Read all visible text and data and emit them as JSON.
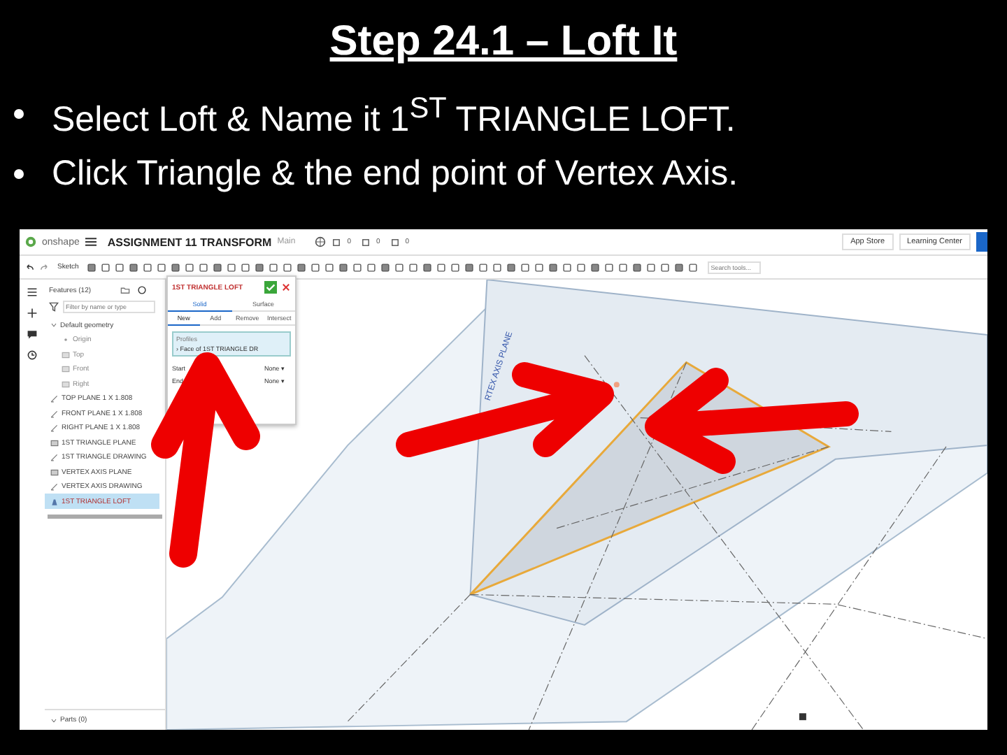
{
  "title": "Step 24.1 – Loft It",
  "bullets": [
    "Select Loft & Name it 1$^{ST}$ TRIANGLE LOFT.",
    "Click Triangle & the end point of Vertex Axis."
  ],
  "app": {
    "logo": "onshape",
    "document": "ASSIGNMENT 11 TRANSFORM",
    "branch": "Main",
    "counts": [
      "0",
      "0",
      "0"
    ],
    "header_buttons": [
      "App Store",
      "Learning Center"
    ],
    "toolbar": {
      "sketch": "Sketch",
      "search": {
        "placeholder": "Search tools..."
      }
    }
  },
  "features": {
    "title": "Features (12)",
    "filter": {
      "placeholder": "Filter by name or type"
    },
    "tree": [
      {
        "label": "Default geometry",
        "kind": "folder",
        "expanded": true,
        "selected": false,
        "children": [
          {
            "label": "Origin",
            "kind": "origin",
            "selected": false
          },
          {
            "label": "Top",
            "kind": "plane",
            "selected": false
          },
          {
            "label": "Front",
            "kind": "plane",
            "selected": false
          },
          {
            "label": "Right",
            "kind": "plane",
            "selected": false
          }
        ]
      },
      {
        "label": "TOP PLANE 1 X 1.808",
        "kind": "sketch",
        "selected": false
      },
      {
        "label": "FRONT PLANE 1 X 1.808",
        "kind": "sketch",
        "selected": false
      },
      {
        "label": "RIGHT PLANE 1 X 1.808",
        "kind": "sketch",
        "selected": false
      },
      {
        "label": "1ST TRIANGLE PLANE",
        "kind": "plane",
        "selected": false
      },
      {
        "label": "1ST TRIANGLE DRAWING",
        "kind": "sketch",
        "selected": false
      },
      {
        "label": "VERTEX AXIS PLANE",
        "kind": "plane",
        "selected": false
      },
      {
        "label": "VERTEX AXIS DRAWING",
        "kind": "sketch",
        "selected": false
      },
      {
        "label": "1ST TRIANGLE LOFT",
        "kind": "loft",
        "selected": true
      }
    ],
    "parts": {
      "label": "Parts (0)",
      "expanded": true
    }
  },
  "dialog": {
    "title": "1ST TRIANGLE LOFT",
    "tabs": [
      {
        "label": "Solid",
        "selected": true
      },
      {
        "label": "Surface",
        "selected": false
      }
    ],
    "operations": [
      {
        "label": "New",
        "selected": true
      },
      {
        "label": "Add",
        "selected": false
      },
      {
        "label": "Remove",
        "selected": false
      },
      {
        "label": "Intersect",
        "selected": false
      }
    ],
    "profiles": {
      "label": "Profiles",
      "items": [
        "› Face of 1ST TRIANGLE DR"
      ]
    },
    "fields": [
      {
        "label": "Start",
        "value": "None ▾"
      },
      {
        "label": "End",
        "value": "None ▾"
      }
    ]
  },
  "viewport": {
    "plane_label": "RTEX AXIS PLANE"
  }
}
